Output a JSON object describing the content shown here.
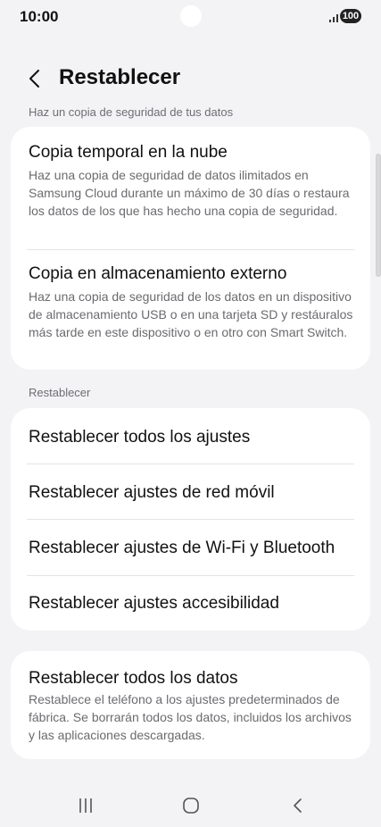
{
  "status_bar": {
    "time": "10:00",
    "battery": "100",
    "signal_icon": "signal-bars-icon"
  },
  "header": {
    "back_icon": "chevron-left-icon",
    "title": "Restablecer"
  },
  "backup_section": {
    "label": "Haz un copia de seguridad de tus datos",
    "items": [
      {
        "title": "Copia temporal en la nube",
        "description": "Haz una copia de seguridad de datos ilimitados en Samsung Cloud durante un máximo de 30 días o restaura los datos de los que has hecho una copia de seguridad."
      },
      {
        "title": "Copia en almacenamiento externo",
        "description": "Haz una copia de seguridad de los datos en un dispositivo de almacenamiento USB o en una tarjeta SD y restáuralos más tarde en este dispositivo o en otro con Smart Switch."
      }
    ]
  },
  "reset_section": {
    "label": "Restablecer",
    "items": [
      {
        "title": "Restablecer todos los ajustes"
      },
      {
        "title": "Restablecer ajustes de red móvil"
      },
      {
        "title": "Restablecer ajustes de Wi-Fi y Bluetooth"
      },
      {
        "title": "Restablecer ajustes accesibilidad"
      }
    ]
  },
  "factory_reset": {
    "title": "Restablecer todos los datos",
    "description": "Restablece el teléfono a los ajustes predeterminados de fábrica. Se borrarán todos los datos, incluidos los archivos y las aplicaciones descargadas."
  },
  "nav_bar": {
    "recent_icon": "recent-apps-icon",
    "home_icon": "home-icon",
    "back_icon": "back-arrow-icon"
  }
}
